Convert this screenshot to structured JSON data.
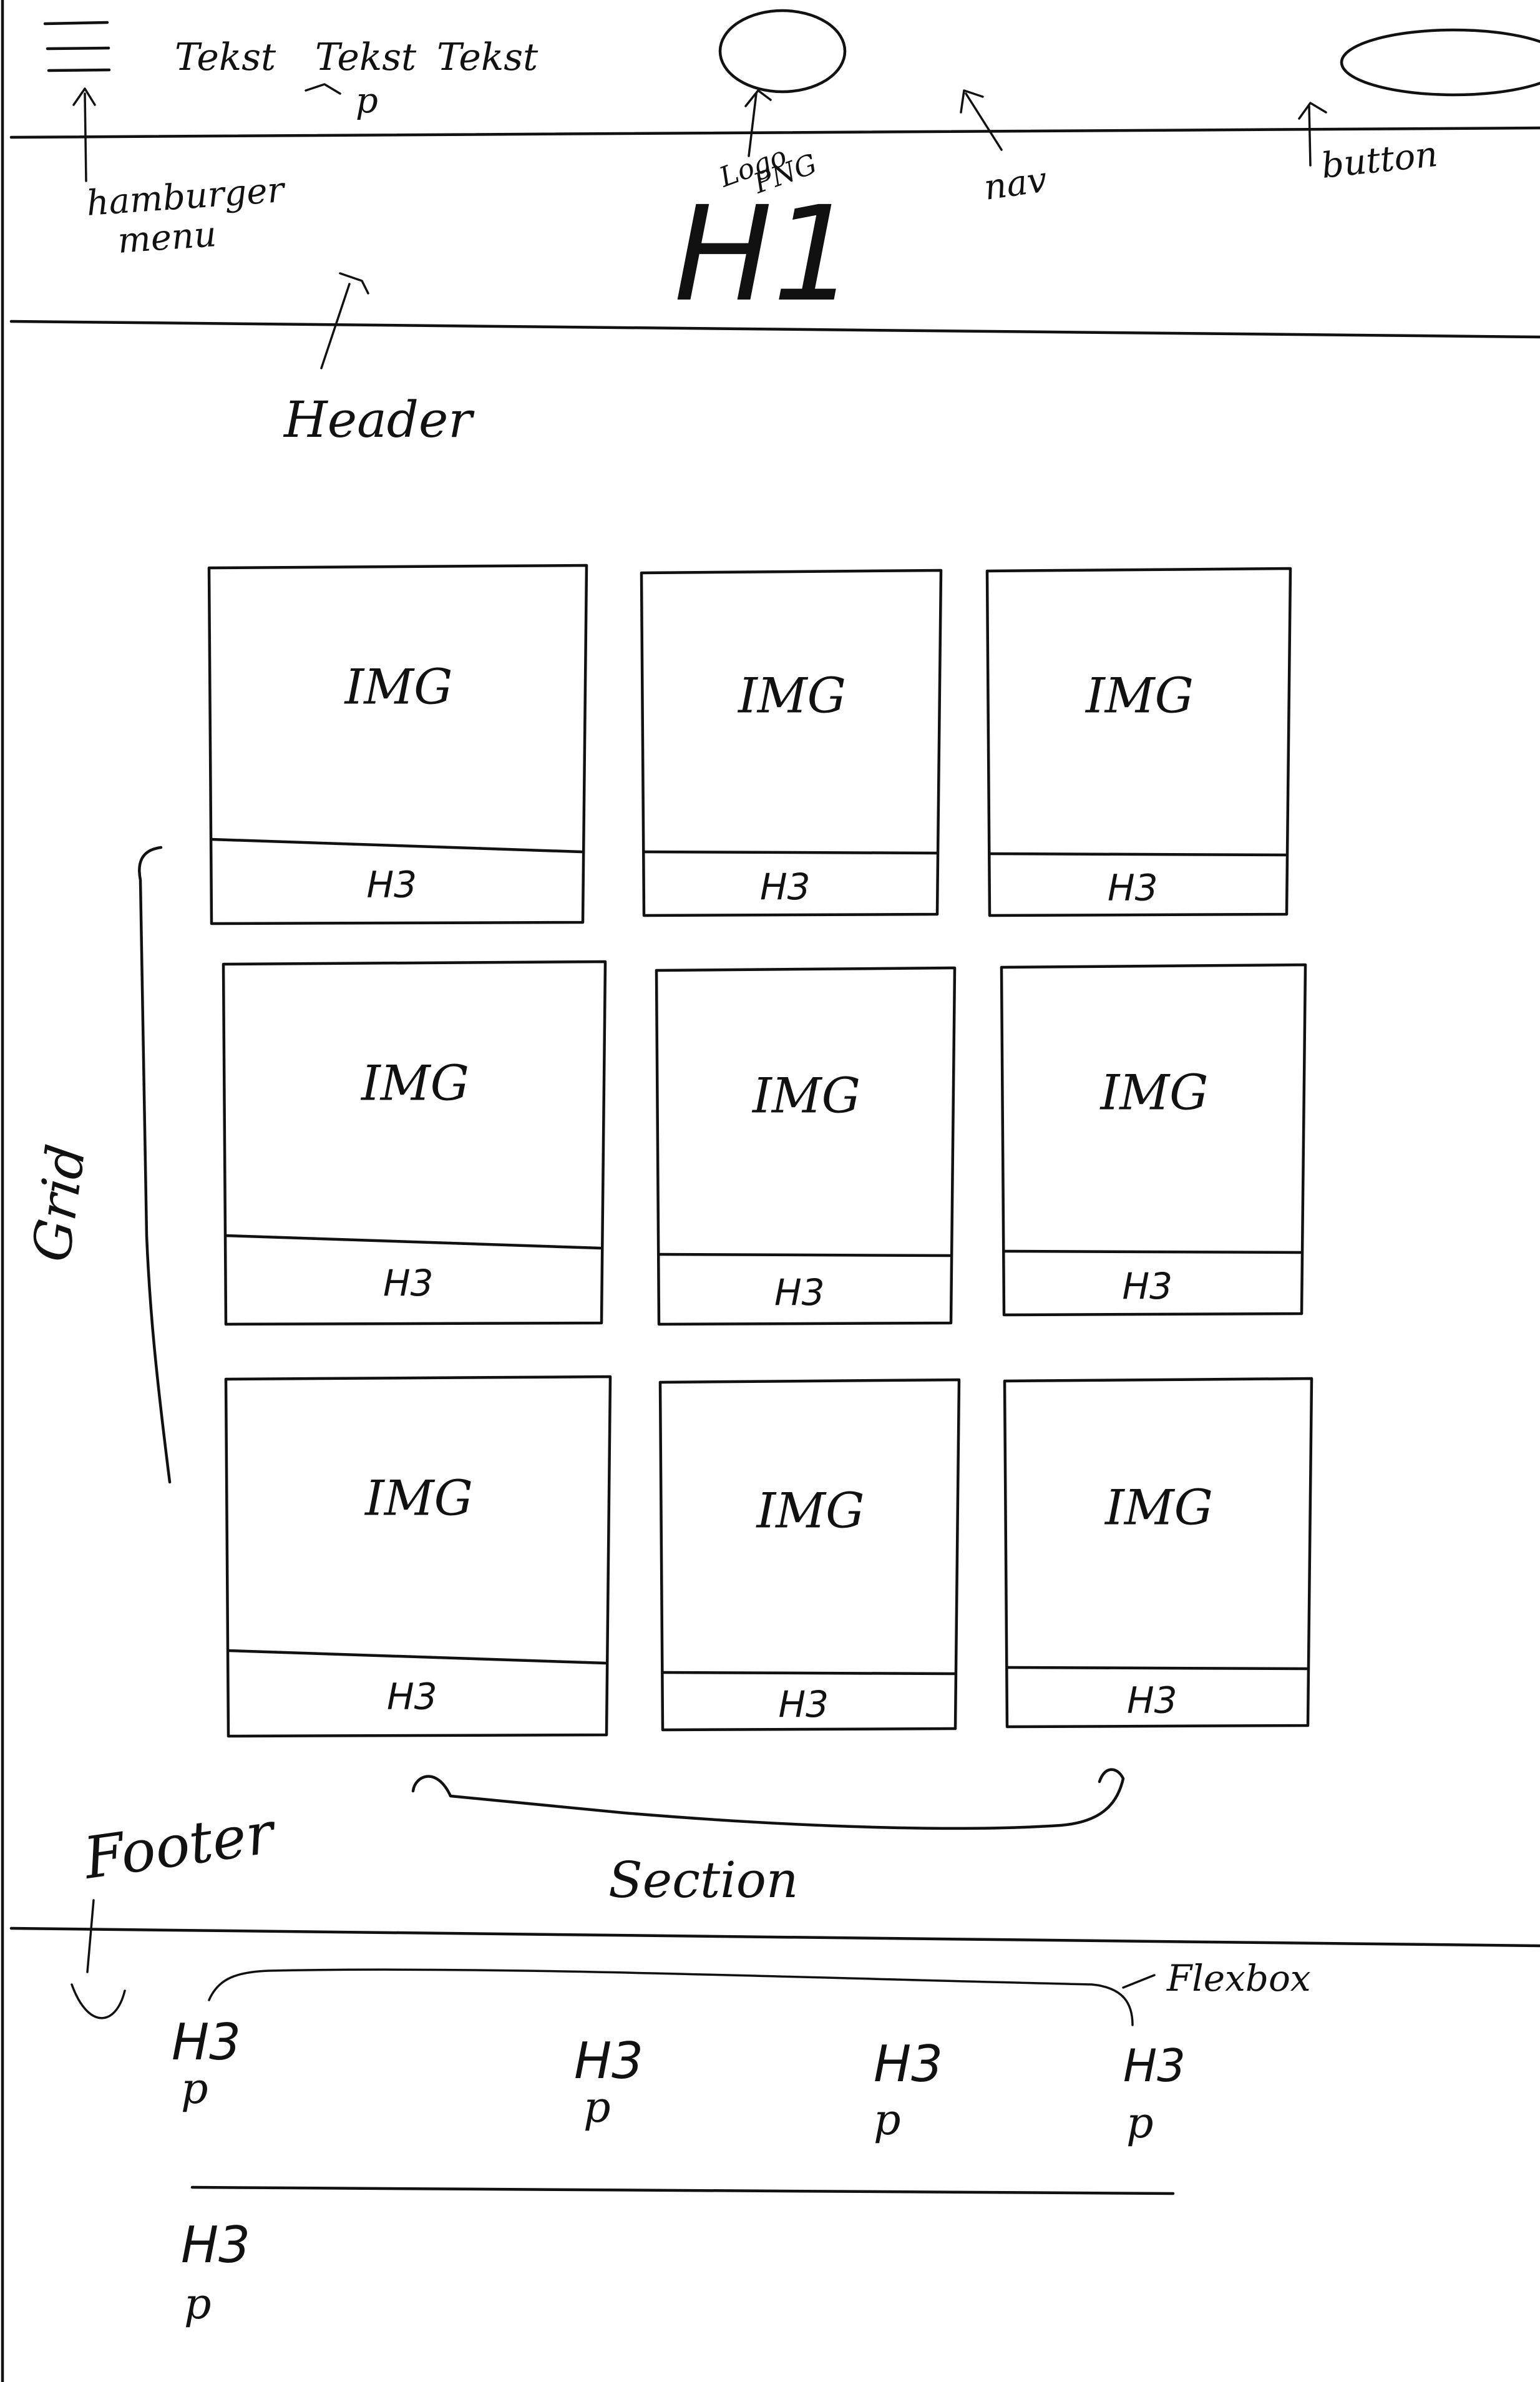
{
  "header": {
    "hamburger_label": "hamburger",
    "hamburger_label_2": "menu",
    "nav_texts": [
      "Tekst",
      "Tekst",
      "Tekst"
    ],
    "nav_p": "p",
    "logo_label": "Logo",
    "logo_label_2": "PNG",
    "nav_label": "nav",
    "button_label": "button",
    "h1": "H1",
    "header_label": "Header"
  },
  "section": {
    "grid_label": "Grid",
    "section_label": "Section",
    "cards": [
      {
        "img": "IMG",
        "h3": "H3"
      },
      {
        "img": "IMG",
        "h3": "H3"
      },
      {
        "img": "IMG",
        "h3": "H3"
      },
      {
        "img": "IMG",
        "h3": "H3"
      },
      {
        "img": "IMG",
        "h3": "H3"
      },
      {
        "img": "IMG",
        "h3": "H3"
      },
      {
        "img": "IMG",
        "h3": "H3"
      },
      {
        "img": "IMG",
        "h3": "H3"
      },
      {
        "img": "IMG",
        "h3": "H3"
      }
    ]
  },
  "footer": {
    "footer_label": "Footer",
    "flexbox_label": "Flexbox",
    "columns": [
      {
        "h3": "H3",
        "p": "p"
      },
      {
        "h3": "H3",
        "p": "p"
      },
      {
        "h3": "H3",
        "p": "p"
      },
      {
        "h3": "H3",
        "p": "p"
      }
    ],
    "bottom": {
      "h3": "H3",
      "p": "p"
    }
  }
}
